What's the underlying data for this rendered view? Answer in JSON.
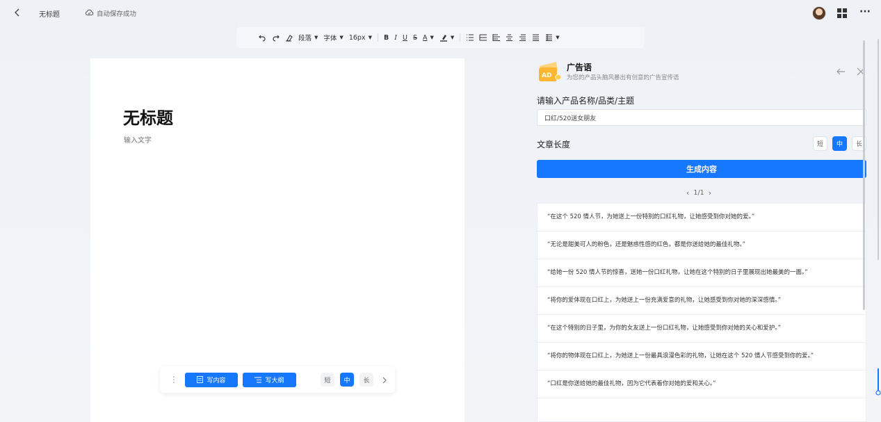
{
  "header": {
    "doc_title": "无标题",
    "save_status": "自动保存成功"
  },
  "toolbar": {
    "paragraph_label": "段落",
    "font_label": "字体",
    "size_label": "16px",
    "bold": "B",
    "italic": "I",
    "underline": "U",
    "strike": "S",
    "font_color": "A"
  },
  "editor": {
    "title": "无标题",
    "placeholder": "输入文字",
    "float_bar": {
      "write_content": "写内容",
      "write_outline": "写大纲",
      "short": "短",
      "medium": "中",
      "long": "长",
      "selected": "中"
    }
  },
  "panel": {
    "logo_text": "AD",
    "title": "广告语",
    "subtitle": "为您的产品头脑风暴出有创意的广告宣传语",
    "input_label": "请输入产品名称/品类/主题",
    "input_value": "口红/520送女朋友",
    "length_label": "文章长度",
    "length_options": [
      "短",
      "中",
      "长"
    ],
    "length_selected": "中",
    "generate_label": "生成内容",
    "pager": "1/1",
    "results": [
      "“在这个 520 情人节，为她送上一份特别的口红礼物，让她感受到你对她的爱。”",
      "“无论是甜美可人的粉色，还是魅惑性感的红色，都是你送给她的最佳礼物。”",
      "“给她一份 520 情人节的惊喜，送她一份口红礼物，让她在这个特别的日子里展现出她最美的一面。”",
      "“将你的爱体现在口红上，为她送上一份充满爱意的礼物，让她感受到你对她的深深感情。”",
      "“在这个特别的日子里，为你的女友送上一份口红礼物，让她感受到你对她的关心和爱护。”",
      "“将你的物体现在口红上，为她送上一份最具浪漫色彩的礼物，让她在这个 520 情人节感受到你的爱。”",
      "“口红是你送给她的最佳礼物，因为它代表着你对她的爱和关心。”"
    ]
  },
  "colors": {
    "accent": "#1677ff",
    "background": "#eef1f6"
  }
}
